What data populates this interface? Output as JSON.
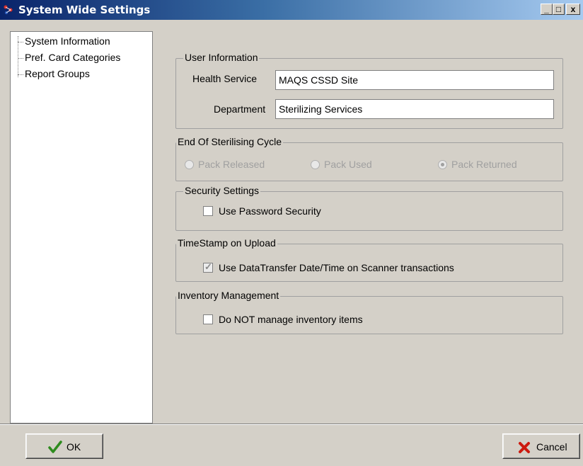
{
  "window": {
    "title": "System Wide Settings",
    "minimize_glyph": "_",
    "maximize_glyph": "□",
    "close_glyph": "x"
  },
  "tree": {
    "items": [
      {
        "label": "System Information"
      },
      {
        "label": "Pref. Card Categories"
      },
      {
        "label": "Report Groups"
      }
    ]
  },
  "user_info": {
    "title": "User Information",
    "health_service_label": "Health Service",
    "health_service_value": "MAQS CSSD Site",
    "department_label": "Department",
    "department_value": "Sterilizing Services"
  },
  "end_cycle": {
    "title": "End Of Sterilising Cycle",
    "options": [
      {
        "label": "Pack Released",
        "selected": false
      },
      {
        "label": "Pack Used",
        "selected": false
      },
      {
        "label": "Pack Returned",
        "selected": true
      }
    ]
  },
  "security": {
    "title": "Security Settings",
    "use_password_label": "Use Password Security",
    "use_password_checked": false
  },
  "timestamp": {
    "title": "TimeStamp on Upload",
    "use_datatransfer_label": "Use DataTransfer Date/Time on Scanner transactions",
    "use_datatransfer_checked": true
  },
  "inventory": {
    "title": "Inventory Management",
    "dont_manage_label": "Do NOT manage inventory items",
    "dont_manage_checked": false
  },
  "buttons": {
    "ok_label": "OK",
    "cancel_label": "Cancel"
  },
  "colors": {
    "title_bar_start": "#0a246a",
    "title_bar_end": "#a6caf0",
    "ok_check": "#2e8b1e",
    "cancel_x": "#cc1a0f"
  }
}
